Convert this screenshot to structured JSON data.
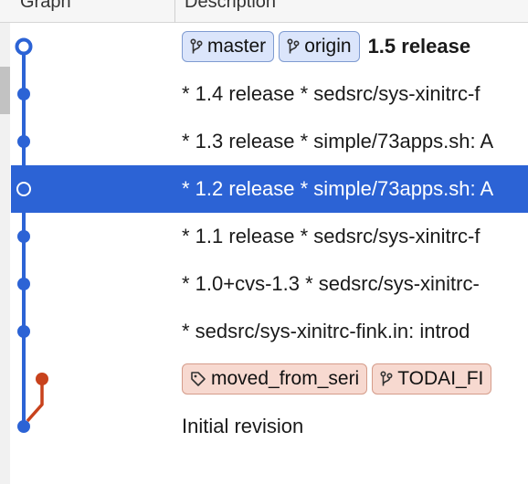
{
  "header": {
    "graph_label": "Graph",
    "description_label": "Description"
  },
  "rows": [
    {
      "refs": [
        {
          "type": "branch",
          "name": "master"
        },
        {
          "type": "branch",
          "name": "origin"
        }
      ],
      "title": "1.5 release",
      "selected": false
    },
    {
      "text": "* 1.4 release * sedsrc/sys-xinitrc-f",
      "selected": false
    },
    {
      "text": "* 1.3 release * simple/73apps.sh: A",
      "selected": false
    },
    {
      "text": "* 1.2 release * simple/73apps.sh: A",
      "selected": true
    },
    {
      "text": "* 1.1 release * sedsrc/sys-xinitrc-f",
      "selected": false
    },
    {
      "text": "* 1.0+cvs-1.3 * sedsrc/sys-xinitrc-",
      "selected": false
    },
    {
      "text": "* sedsrc/sys-xinitrc-fink.in: introd",
      "selected": false
    },
    {
      "refs": [
        {
          "type": "tag",
          "name": "moved_from_seri"
        },
        {
          "type": "branch",
          "name": "TODAI_FI"
        }
      ],
      "selected": false
    },
    {
      "text": "Initial revision",
      "selected": false
    }
  ],
  "colors": {
    "graph_main": "#2c63d5",
    "graph_side": "#c8421c",
    "selection": "#2c63d5"
  }
}
